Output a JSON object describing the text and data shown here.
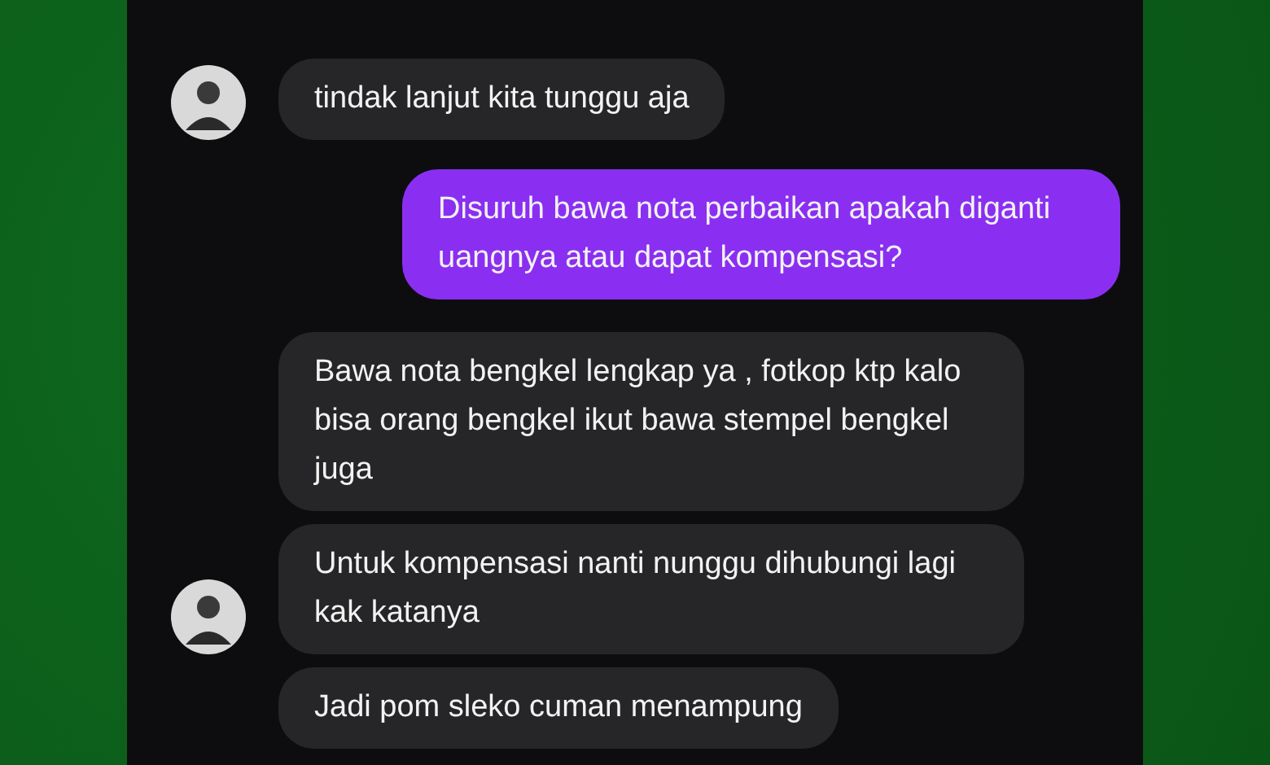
{
  "messages": [
    {
      "kind": "received",
      "avatar": true,
      "text": "tindak lanjut kita tunggu aja"
    },
    {
      "kind": "sent",
      "avatar": false,
      "text": "Disuruh bawa nota perbaikan apakah diganti uangnya atau dapat kompensasi?"
    },
    {
      "kind": "received",
      "avatar": false,
      "text": "Bawa nota bengkel lengkap ya , fotkop ktp kalo bisa orang bengkel ikut bawa stempel bengkel juga"
    },
    {
      "kind": "received",
      "avatar": true,
      "text": "Untuk kompensasi nanti nunggu dihubungi lagi kak katanya"
    },
    {
      "kind": "received",
      "avatar": false,
      "text": "Jadi pom sleko cuman menampung"
    }
  ]
}
